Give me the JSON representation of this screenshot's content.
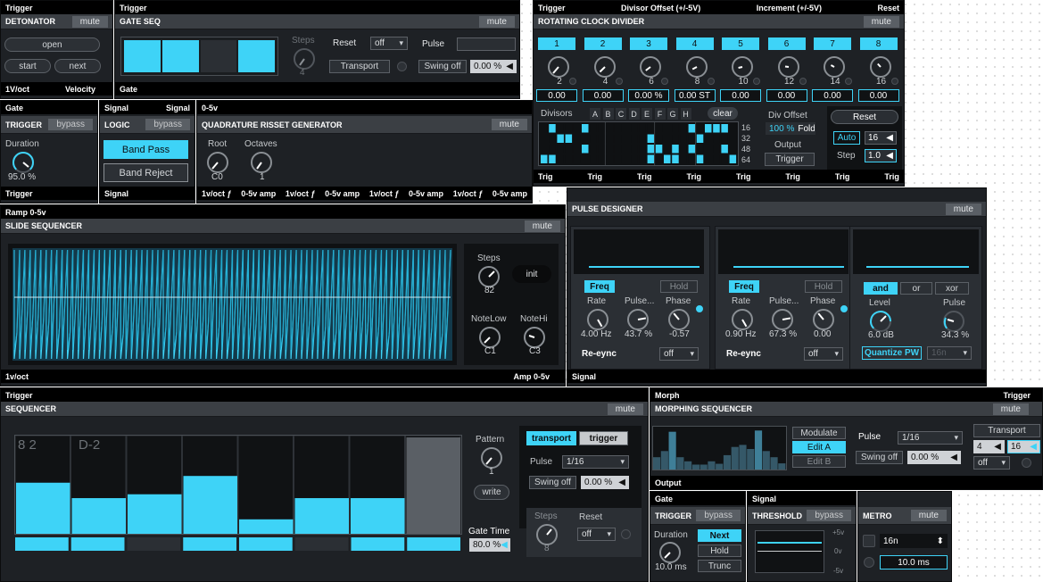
{
  "detonator": {
    "io_top": "Trigger",
    "title": "DETONATOR",
    "mute": "mute",
    "open": "open",
    "start": "start",
    "next": "next",
    "out1": "1V/oct",
    "out2": "Velocity"
  },
  "gate_seq": {
    "io_top": "Trigger",
    "title": "GATE SEQ",
    "mute": "mute",
    "steps_label": "Steps",
    "steps_value": "4",
    "reset_label": "Reset",
    "reset_value": "off",
    "pulse_label": "Pulse",
    "transport": "Transport",
    "swing_label": "Swing off",
    "swing_value": "0.00 %",
    "cells": [
      1,
      1,
      0,
      1
    ],
    "out": "Gate"
  },
  "rcd": {
    "io_top": [
      "Trigger",
      "Divisor Offset (+/-5V)",
      "Increment (+/-5V)",
      "Reset"
    ],
    "title": "ROTATING CLOCK DIVIDER",
    "mute": "mute",
    "channels": [
      "1",
      "2",
      "3",
      "4",
      "5",
      "6",
      "7",
      "8"
    ],
    "knob_values": [
      "2",
      "4",
      "6",
      "8",
      "10",
      "12",
      "14",
      "16"
    ],
    "offsets": [
      "0.00",
      "0.00",
      "0.00 %",
      "0.00 ST",
      "0.00",
      "0.00",
      "0.00",
      "0.00"
    ],
    "divisors_label": "Divisors",
    "letters": [
      "A",
      "B",
      "C",
      "D",
      "E",
      "F",
      "G",
      "H"
    ],
    "clear": "clear",
    "row_labels": [
      "16",
      "32",
      "48",
      "64"
    ],
    "div_offset_label": "Div Offset",
    "div_offset_value": "100 %",
    "fold": "Fold",
    "output_label": "Output",
    "output_value": "Trigger",
    "reset": "Reset",
    "auto": "Auto",
    "auto_value": "16",
    "step_label": "Step",
    "step_value": "1.0",
    "outs": [
      "Trig",
      "Trig",
      "Trig",
      "Trig",
      "Trig",
      "Trig",
      "Trig",
      "Trig"
    ]
  },
  "trigger1": {
    "io_top": "Gate",
    "title": "TRIGGER",
    "bypass": "bypass",
    "duration_label": "Duration",
    "duration_value": "95.0 %",
    "out": "Trigger"
  },
  "logic": {
    "io_top": [
      "Signal",
      "Signal"
    ],
    "title": "LOGIC",
    "bypass": "bypass",
    "band_pass": "Band Pass",
    "band_reject": "Band Reject",
    "out": "Signal"
  },
  "qrg": {
    "io_top": "0-5v",
    "title": "QUADRATURE RISSET GENERATOR",
    "mute": "mute",
    "root_label": "Root",
    "root_value": "C0",
    "octaves_label": "Octaves",
    "octaves_value": "1",
    "outs": [
      "1v/oct ƒ",
      "0-5v amp",
      "1v/oct ƒ",
      "0-5v amp",
      "1v/oct ƒ",
      "0-5v amp",
      "1v/oct ƒ",
      "0-5v amp"
    ]
  },
  "slide": {
    "io_top": "Ramp 0-5v",
    "title": "SLIDE SEQUENCER",
    "mute": "mute",
    "steps_label": "Steps",
    "steps_value": "82",
    "init": "init",
    "notelow_label": "NoteLow",
    "notelow_value": "C1",
    "notehi_label": "NoteHi",
    "notehi_value": "C3",
    "out1": "1v/oct",
    "out2": "Amp 0-5v"
  },
  "pulse_designer": {
    "title": "PULSE DESIGNER",
    "mute": "mute",
    "units": [
      {
        "mode": "Freq",
        "hold": "Hold",
        "rate_label": "Rate",
        "rate": "4.00 Hz",
        "pulse_label": "Pulse...",
        "pulse": "43.7 %",
        "phase_label": "Phase",
        "phase": "-0.57",
        "resync": "Re-eync",
        "resync_value": "off"
      },
      {
        "mode": "Freq",
        "hold": "Hold",
        "rate_label": "Rate",
        "rate": "0.90 Hz",
        "pulse_label": "Pulse...",
        "pulse": "67.3 %",
        "phase_label": "Phase",
        "phase": "0.00",
        "resync": "Re-eync",
        "resync_value": "off"
      }
    ],
    "logic_buttons": [
      "and",
      "or",
      "xor"
    ],
    "level_label": "Level",
    "level_value": "6.0 dB",
    "pulse_label": "Pulse",
    "pulse_value": "34.3 %",
    "quantize": "Quantize PW",
    "quantize_value": "16n",
    "out": "Signal"
  },
  "sequencer": {
    "io_top": "Trigger",
    "title": "SEQUENCER",
    "mute": "mute",
    "step_label1": "8 2",
    "step_label2": "D-2",
    "bars": [
      0.53,
      0.37,
      0.41,
      0.6,
      0.15,
      0.37,
      0.37,
      1.0
    ],
    "gates": [
      1,
      1,
      0,
      1,
      1,
      0,
      1,
      1
    ],
    "pattern_label": "Pattern",
    "pattern_value": "1",
    "write": "write",
    "gate_time_label": "Gate Time",
    "gate_time_value": "80.0 %",
    "transport": "transport",
    "trigger": "trigger",
    "pulse_label": "Pulse",
    "pulse_value": "1/16",
    "swing_label": "Swing off",
    "swing_value": "0.00 %",
    "steps_label": "Steps",
    "steps_value": "8",
    "reset_label": "Reset",
    "reset_value": "off"
  },
  "morph": {
    "io_top": [
      "Morph",
      "Trigger"
    ],
    "title": "MORPHING SEQUENCER",
    "mute": "mute",
    "modulate": "Modulate",
    "edit_a": "Edit A",
    "edit_b": "Edit B",
    "pulse_label": "Pulse",
    "pulse_value": "1/16",
    "swing_label": "Swing off",
    "swing_value": "0.00 %",
    "transport": "Transport",
    "t1": "4",
    "t2": "16",
    "t3": "off",
    "out": "Output",
    "bars": [
      0.3,
      0.45,
      0.92,
      0.3,
      0.2,
      0.12,
      0.12,
      0.2,
      0.14,
      0.35,
      0.55,
      0.6,
      0.5,
      0.95,
      0.45,
      0.3,
      0.15
    ]
  },
  "trigger2": {
    "io_top": "Gate",
    "title": "TRIGGER",
    "bypass": "bypass",
    "duration_label": "Duration",
    "duration_value": "10.0 ms",
    "next": "Next",
    "hold": "Hold",
    "trunc": "Trunc"
  },
  "threshold": {
    "io_top": "Signal",
    "title": "THRESHOLD",
    "bypass": "bypass",
    "scale": [
      "+5v",
      "0v",
      "-5v"
    ]
  },
  "metro": {
    "title": "METRO",
    "mute": "mute",
    "rate": "16n",
    "time": "10.0 ms"
  }
}
